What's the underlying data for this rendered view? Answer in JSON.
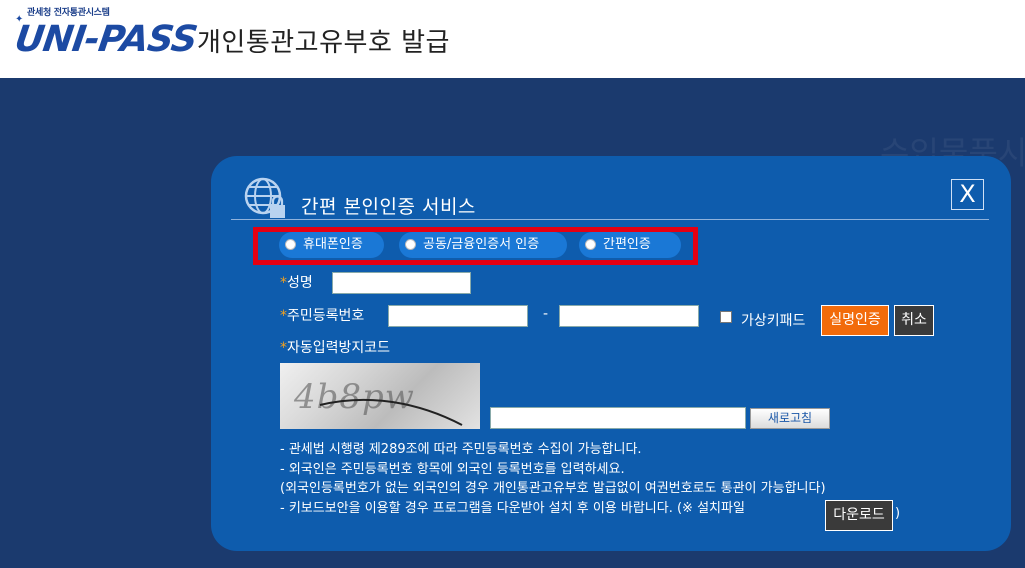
{
  "header": {
    "logo_small": "관세청 전자통관시스템",
    "logo_main": "UNI-PASS",
    "page_title": "개인통관고유부호 발급",
    "background_text": "수입물품시"
  },
  "dialog": {
    "title": "간편 본인인증 서비스",
    "close_label": "X",
    "auth_options": [
      {
        "label": "휴대폰인증"
      },
      {
        "label": "공동/금융인증서 인증"
      },
      {
        "label": "간편인증"
      }
    ],
    "form": {
      "required_mark": "*",
      "name_label": "성명",
      "name_value": "",
      "rrn_label": "주민등록번호",
      "rrn_first_value": "",
      "rrn_separator": "-",
      "rrn_second_value": "",
      "virtual_keypad_label": "가상키패드",
      "verify_button": "실명인증",
      "cancel_button": "취소",
      "captcha_label": "자동입력방지코드",
      "captcha_text": "4b8pw",
      "captcha_input_value": "",
      "refresh_button": "새로고침"
    },
    "notes": [
      "- 관세법 시행령 제289조에 따라 주민등록번호 수집이 가능합니다.",
      "- 외국인은 주민등록번호 항목에 외국인 등록번호를 입력하세요.",
      "(외국인등록번호가 없는 외국인의 경우 개인통관고유부호 발급없이 여권번호로도 통관이 가능합니다)",
      "- 키보드보안을 이용할 경우 프로그램을 다운받아 설치 후 이용 바랍니다. (※ 설치파일"
    ],
    "download_button": "다운로드",
    "notes_suffix": ")"
  },
  "colors": {
    "page_background": "#1b3a6e",
    "dialog_background": "#0e5cad",
    "highlight_border": "#e60012",
    "verify_button": "#f26b0a",
    "required_star": "#f5a21d"
  }
}
